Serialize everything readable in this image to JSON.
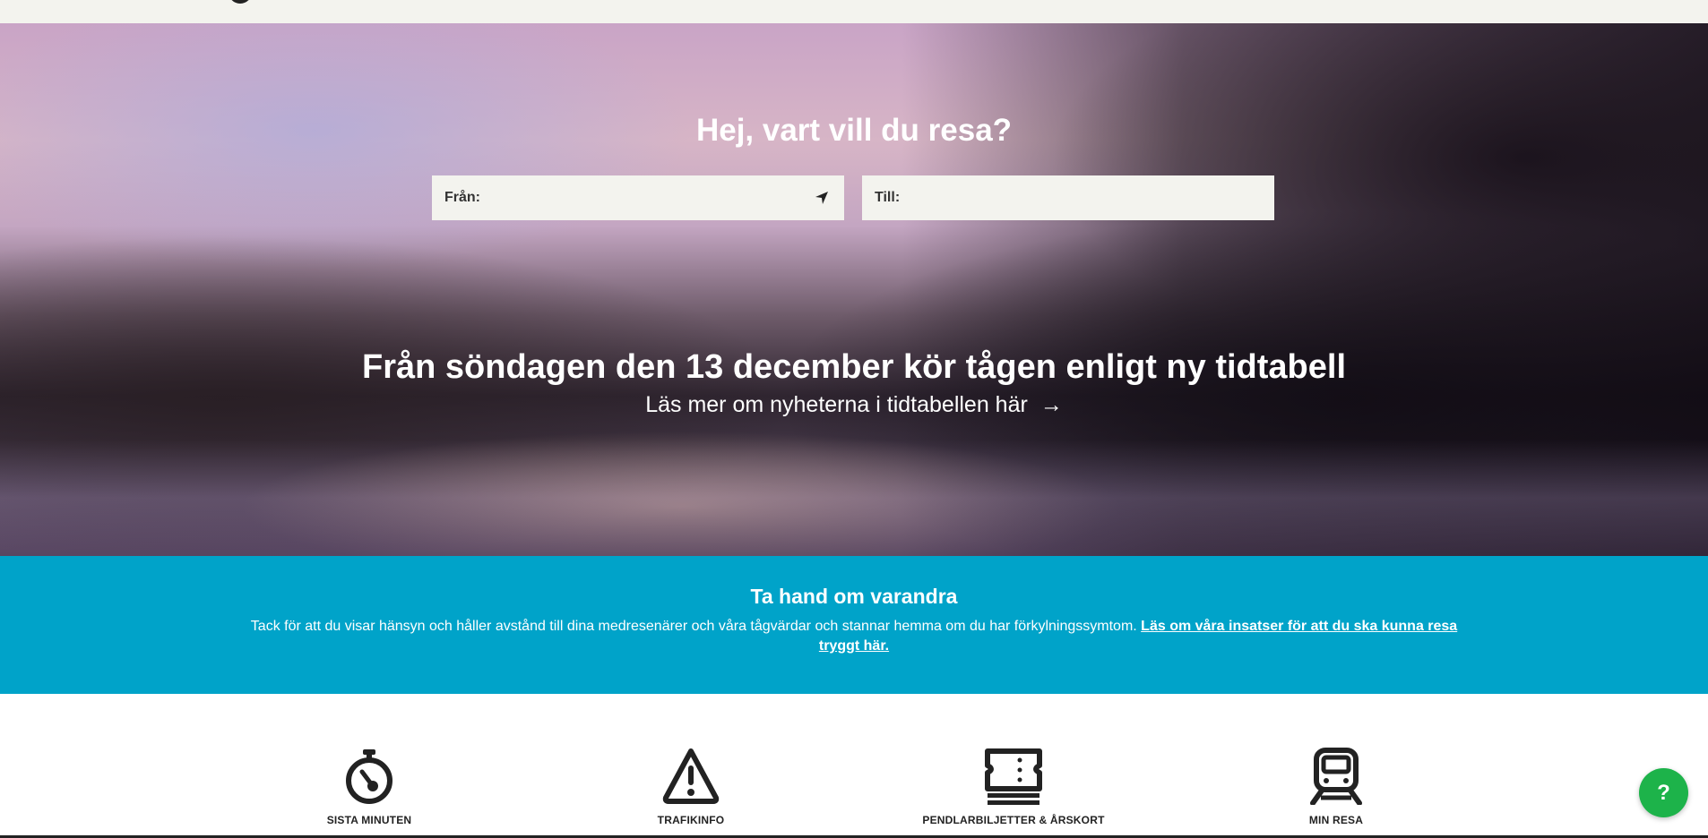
{
  "hero": {
    "title": "Hej, vart vill du resa?",
    "from_label": "Från:",
    "from_value": "",
    "to_label": "Till:",
    "to_value": "",
    "locate_icon": "navigation-arrow-icon",
    "news_title": "Från söndagen den 13 december kör tågen enligt ny tidtabell",
    "news_link": "Läs mer om nyheterna i tidtabellen här",
    "news_arrow": "→"
  },
  "info": {
    "title": "Ta hand om varandra",
    "text": "Tack för att du visar hänsyn och håller avstånd till dina medresenärer och våra tågvärdar och stannar hemma om du har förkylningssymtom.",
    "link": "Läs om våra insatser för att du ska kunna resa tryggt här.",
    "background": "#00a3c9"
  },
  "shortcuts": [
    {
      "label": "SISTA MINUTEN",
      "icon": "stopwatch-icon"
    },
    {
      "label": "TRAFIKINFO",
      "icon": "warning-triangle-icon"
    },
    {
      "label": "PENDLARBILJETTER & ÅRSKORT",
      "icon": "ticket-icon"
    },
    {
      "label": "MIN RESA",
      "icon": "train-icon"
    }
  ],
  "help": {
    "label": "?",
    "color": "#1db34a"
  }
}
